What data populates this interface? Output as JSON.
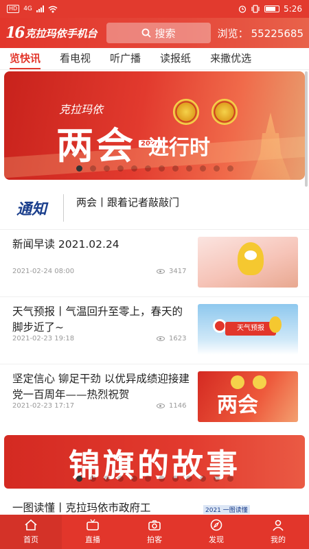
{
  "statusbar": {
    "network_badge": "HD",
    "network_type": "4G",
    "time": "5:26"
  },
  "header": {
    "logo_number": "16",
    "logo_text": "克拉玛依手机台",
    "search_placeholder": "搜索",
    "views_label": "浏览：",
    "views_count": "55225685"
  },
  "tabs": [
    {
      "label": "览快讯",
      "active": true
    },
    {
      "label": "看电视",
      "active": false
    },
    {
      "label": "听广播",
      "active": false
    },
    {
      "label": "读报纸",
      "active": false
    },
    {
      "label": "来撒优选",
      "active": false
    }
  ],
  "banner": {
    "brand": "克拉玛依",
    "headline": "两会",
    "year": "2021",
    "subline": "进行时",
    "dot_count": 12,
    "active_dot": 0
  },
  "notice": {
    "label": "通知",
    "text": "两会丨跟着记者敲敲门"
  },
  "news": [
    {
      "title": "新闻早读 2021.02.24",
      "date": "2021-02-24 08:00",
      "views": "3417"
    },
    {
      "title": "天气预报丨气温回升至零上，春天的脚步近了~",
      "date": "2021-02-23 19:18",
      "views": "1623",
      "thumb_label": "天气预报"
    },
    {
      "title": "坚定信心 铆足干劲 以优异成绩迎接建党一百周年——热烈祝贺",
      "date": "2021-02-23 17:17",
      "views": "1146",
      "thumb_label": "两会"
    }
  ],
  "banner2": {
    "headline": "锦旗的故事",
    "dot_count": 12,
    "active_dot": 0
  },
  "news_partial": {
    "title": "一图读懂丨克拉玛依市政府工",
    "tag": "2021 一图读懂"
  },
  "bottomnav": [
    {
      "label": "首页",
      "icon": "home-icon",
      "active": true
    },
    {
      "label": "直播",
      "icon": "tv-icon",
      "active": false
    },
    {
      "label": "拍客",
      "icon": "camera-icon",
      "active": false
    },
    {
      "label": "发现",
      "icon": "compass-icon",
      "active": false
    },
    {
      "label": "我的",
      "icon": "user-icon",
      "active": false
    }
  ],
  "colors": {
    "brand_red": "#e2362b",
    "notice_blue": "#1a3e8c"
  }
}
